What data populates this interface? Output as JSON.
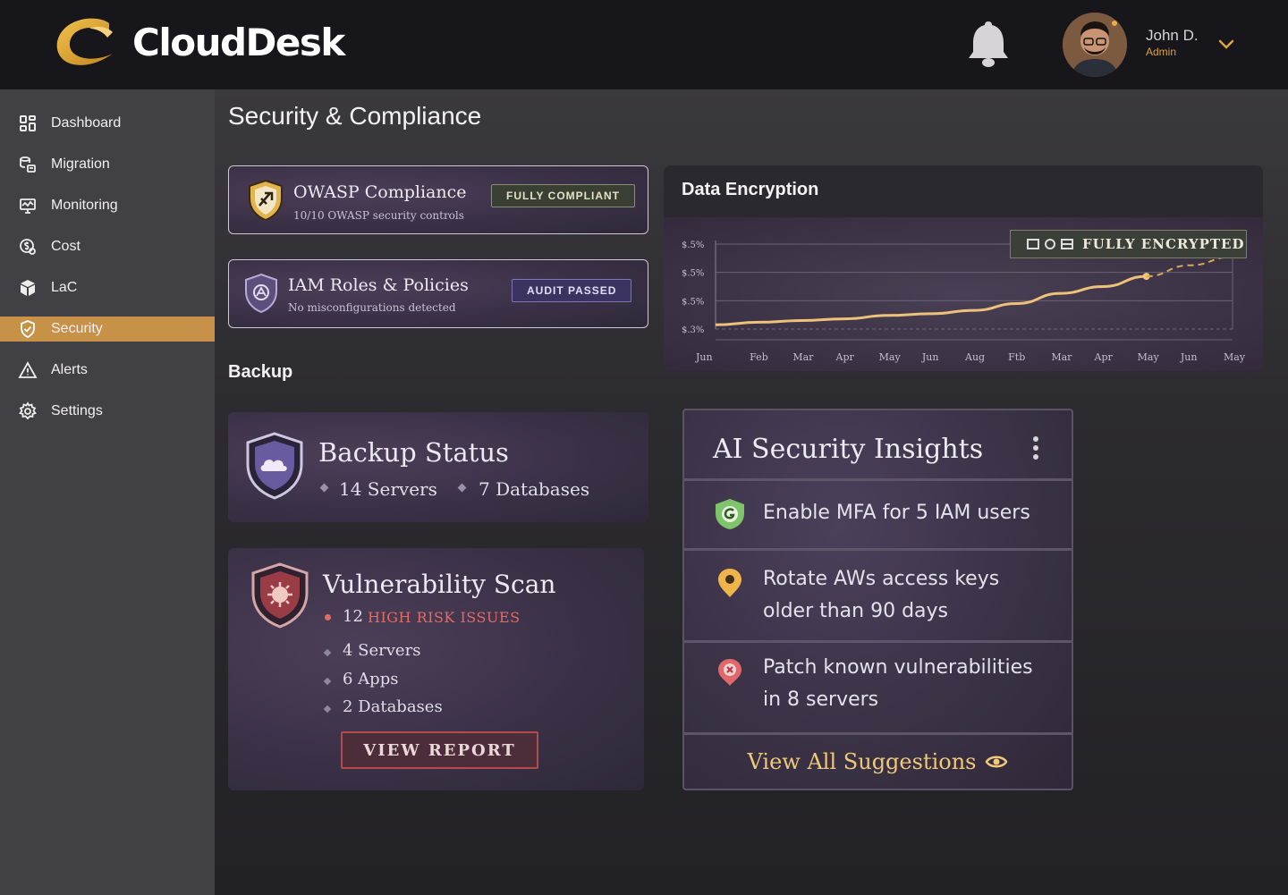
{
  "app": {
    "name": "CloudDesk",
    "colors": {
      "accent": "#c89148",
      "header_bg": "#17161a",
      "sidebar_bg": "#414044"
    }
  },
  "header": {
    "user": {
      "name": "John D.",
      "role": "Admin"
    },
    "icons": [
      "bell-icon",
      "chevron-down-icon"
    ]
  },
  "sidebar": {
    "items": [
      {
        "label": "Dashboard",
        "icon": "dashboard-grid-icon",
        "active": false
      },
      {
        "label": "Migration",
        "icon": "migration-icon",
        "active": false
      },
      {
        "label": "Monitoring",
        "icon": "monitoring-icon",
        "active": false
      },
      {
        "label": "Cost",
        "icon": "cost-icon",
        "active": false
      },
      {
        "label": "LaC",
        "icon": "cube-icon",
        "active": false
      },
      {
        "label": "Security",
        "icon": "shield-check-icon",
        "active": true
      },
      {
        "label": "Alerts",
        "icon": "warning-triangle-icon",
        "active": false
      },
      {
        "label": "Settings",
        "icon": "gear-icon",
        "active": false
      }
    ]
  },
  "page": {
    "title": "Security & Compliance"
  },
  "compliance": {
    "owasp": {
      "title": "OWASP Compliance",
      "subtitle": "10/10 OWASP security controls",
      "badge": "FULLY COMPLIANT"
    },
    "iam": {
      "title": "IAM Roles & Policies",
      "subtitle": "No misconfigurations detected",
      "badge": "AUDIT PASSED"
    }
  },
  "encryption": {
    "title": "Data Encryption",
    "badge": "FULLY ENCRYPTED"
  },
  "chart_data": {
    "type": "line",
    "title": "",
    "y_tick_labels": [
      "$.5%",
      "$.5%",
      "$.5%",
      "$.3%"
    ],
    "categories": [
      "Jun",
      "Feb",
      "Mar",
      "Apr",
      "May",
      "Jun",
      "Aug",
      "Ftb",
      "Mar",
      "Apr",
      "May",
      "Jun",
      "May"
    ],
    "series": [
      {
        "values": [
          0.05,
          0.08,
          0.1,
          0.12,
          0.16,
          0.18,
          0.22,
          0.3,
          0.42,
          0.5,
          0.62,
          null,
          null
        ]
      },
      {
        "style": "dashed",
        "values": [
          null,
          null,
          null,
          null,
          null,
          null,
          null,
          null,
          null,
          null,
          0.62,
          0.75,
          0.85
        ]
      }
    ],
    "ylim": [
      0,
      1
    ],
    "grid": true,
    "legend": "none"
  },
  "backup": {
    "section_label": "Backup",
    "title": "Backup Status",
    "servers": "14 Servers",
    "databases": "7 Databases"
  },
  "vulnerability": {
    "title": "Vulnerability Scan",
    "high_count": "12",
    "high_label": "HIGH RISK ISSUES",
    "items": [
      "4 Servers",
      "6 Apps",
      "2 Databases"
    ],
    "button": "VIEW REPORT"
  },
  "ai": {
    "title": "AI Security Insights",
    "suggestions": [
      {
        "line1": "Enable MFA for 5 IAM users",
        "line2": "",
        "icon": "mfa-shield-icon"
      },
      {
        "line1": "Rotate AWs access keys",
        "line2": "older than 90 days",
        "icon": "key-pin-icon"
      },
      {
        "line1": "Patch known vulnerabilities",
        "line2": "in 8 servers",
        "icon": "patch-alert-icon"
      }
    ],
    "view_all": "View All Suggestions"
  }
}
